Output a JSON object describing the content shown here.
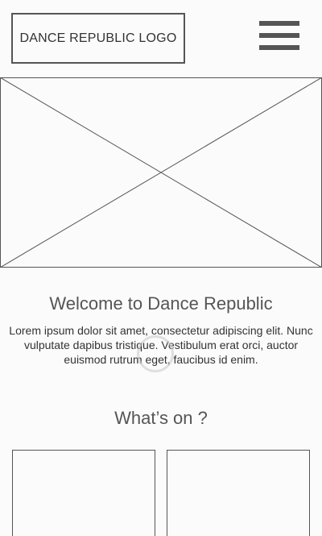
{
  "header": {
    "logo_text": "DANCE REPUBLIC LOGO",
    "menu_icon": "hamburger-menu-icon"
  },
  "hero": {
    "image_placeholder_icon": "image-placeholder-icon"
  },
  "welcome": {
    "title": "Welcome to Dance Republic",
    "body": "Lorem ipsum dolor sit amet, consectetur adipiscing elit. Nunc vulputate dapibus tristique. Vestibulum erat orci, auctor euismod rutrum eget, faucibus id enim."
  },
  "whats_on": {
    "title": "What’s on ?",
    "cards": [
      {},
      {}
    ]
  },
  "colors": {
    "background": "#fbfbfc",
    "wireframe_stroke": "#555555",
    "text": "#333333"
  }
}
